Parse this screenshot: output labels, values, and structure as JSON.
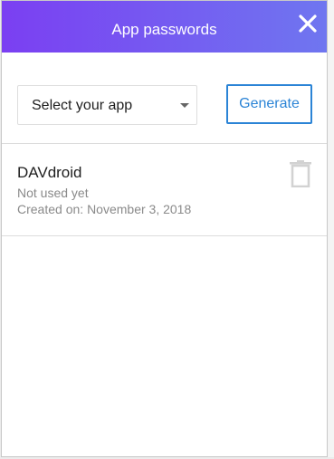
{
  "dialog": {
    "title": "App passwords",
    "close_icon": "close-icon",
    "header_gradient": [
      "#7b3ff2",
      "#6f76f0"
    ]
  },
  "toolbar": {
    "select_value": "Select your app",
    "select_icon": "chevron-down-icon",
    "generate_label": "Generate",
    "accent_color": "#2b84d6"
  },
  "passwords": [
    {
      "name": "DAVdroid",
      "usage": "Not used yet",
      "created_label": "Created on:",
      "created_date": "November 3, 2018",
      "delete_icon": "trash-icon"
    }
  ]
}
